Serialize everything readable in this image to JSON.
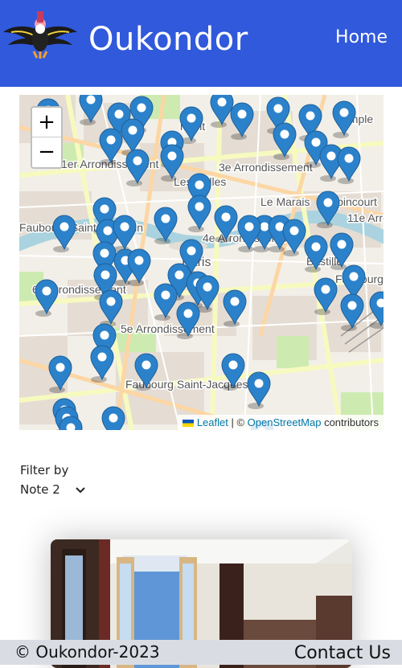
{
  "header": {
    "brand": "Oukondor",
    "nav_home": "Home",
    "logo_icon": "condor-logo-icon",
    "background": "#3159dc"
  },
  "map": {
    "zoom_in": "+",
    "zoom_out": "−",
    "attribution": {
      "leaflet": "Leaflet",
      "separator": " | © ",
      "osm": "OpenStreetMap",
      "suffix": " contributors"
    },
    "labels": [
      "1er Arrondissement",
      "3e Arrondissement",
      "Les Halles",
      "Le Marais",
      "Popincourt",
      "11e Arron",
      "Faubourg Saint-Germain",
      "6e Arrondissement",
      "5e Arrondissement",
      "Paris",
      "Faubourg Saint-Jacques",
      "Bastille",
      "Faubourg",
      "4e Arrondissement",
      "Temple",
      "ment"
    ],
    "marker_icon": "map-marker-icon",
    "marker_color": "#2b82cb"
  },
  "filter": {
    "label": "Filter by",
    "selected": "Note 2",
    "chevron_icon": "chevron-down-icon"
  },
  "footer": {
    "copyright": "© Oukondor-2023",
    "contact": "Contact Us"
  }
}
